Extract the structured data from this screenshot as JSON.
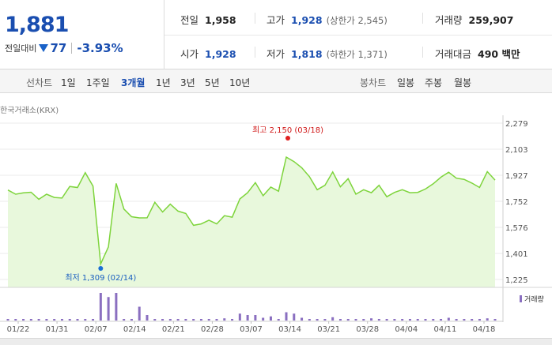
{
  "quote": {
    "price": "1,881",
    "change_label": "전일대비",
    "change": "77",
    "change_pct": "-3.93%"
  },
  "stats": {
    "prev_label": "전일",
    "prev": "1,958",
    "open_label": "시가",
    "open": "1,928",
    "high_label": "고가",
    "high": "1,928",
    "high_limit": "(상한가 2,545)",
    "low_label": "저가",
    "low": "1,818",
    "low_limit": "(하한가 1,371)",
    "vol_label": "거래량",
    "vol": "259,907",
    "amt_label": "거래대금",
    "amt": "490 백만"
  },
  "period_tabs": {
    "label": "선차트",
    "items": [
      "1일",
      "1주일",
      "3개월",
      "1년",
      "3년",
      "5년",
      "10년"
    ],
    "active": "3개월"
  },
  "candle_tabs": {
    "label": "봉차트",
    "items": [
      "일봉",
      "주봉",
      "월봉"
    ]
  },
  "source_label": "한국거래소(KRX)",
  "colors": {
    "line": "#7ed43c",
    "fill": "#e8f8dc",
    "volume": "#8a6fc0",
    "high_dot": "#e02020",
    "low_dot": "#1a6fd4",
    "price_blue": "#1a4eb0"
  },
  "chart_data": {
    "type": "area",
    "y_ticks": [
      "2,279",
      "2,103",
      "1,927",
      "1,752",
      "1,576",
      "1,401",
      "1,225"
    ],
    "ylim": [
      1225,
      2279
    ],
    "x_tick_labels": [
      "01/22",
      "01/31",
      "02/07",
      "02/14",
      "02/21",
      "02/28",
      "03/07",
      "03/14",
      "03/21",
      "03/28",
      "04/04",
      "04/11",
      "04/18"
    ],
    "annotations": {
      "high": "최고 2,150 (03/18)",
      "low": "최저 1,309 (02/14)"
    },
    "volume_label": "거래량",
    "price": [
      1828,
      1800,
      1809,
      1813,
      1766,
      1800,
      1778,
      1774,
      1852,
      1845,
      1945,
      1855,
      1330,
      1445,
      1873,
      1700,
      1648,
      1640,
      1641,
      1745,
      1680,
      1733,
      1686,
      1670,
      1590,
      1600,
      1625,
      1600,
      1655,
      1645,
      1768,
      1810,
      1878,
      1790,
      1848,
      1820,
      2050,
      2020,
      1978,
      1918,
      1830,
      1860,
      1950,
      1850,
      1905,
      1800,
      1830,
      1810,
      1860,
      1783,
      1812,
      1830,
      1810,
      1812,
      1835,
      1870,
      1915,
      1948,
      1908,
      1900,
      1875,
      1845,
      1952,
      1895
    ],
    "volume": [
      2,
      2,
      2,
      1,
      2,
      1,
      2,
      2,
      3,
      2,
      3,
      5,
      100,
      85,
      100,
      4,
      2,
      50,
      20,
      2,
      5,
      2,
      3,
      2,
      1,
      2,
      2,
      3,
      8,
      3,
      25,
      20,
      20,
      10,
      15,
      5,
      30,
      25,
      10,
      5,
      2,
      3,
      12,
      3,
      5,
      2,
      2,
      8,
      2,
      2,
      5,
      2,
      3,
      2,
      5,
      3,
      5,
      10,
      5,
      3,
      2,
      3,
      8,
      5
    ]
  }
}
